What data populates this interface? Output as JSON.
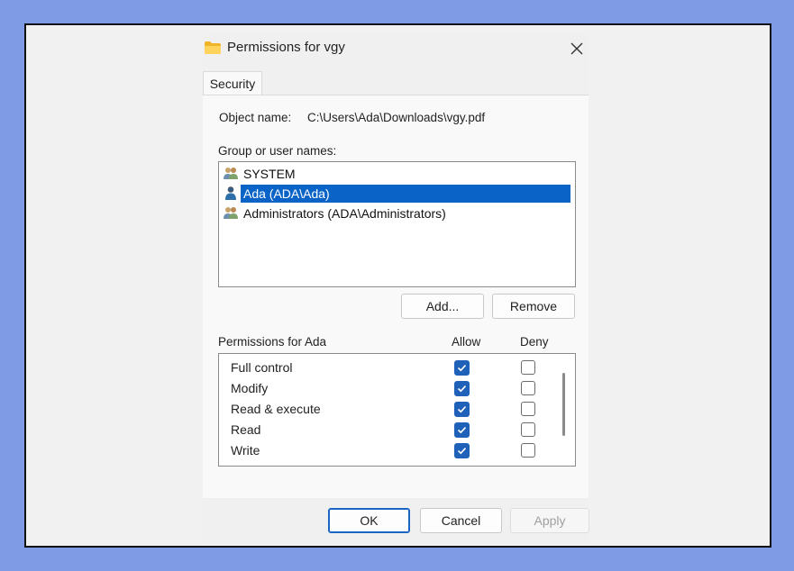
{
  "window": {
    "title": "Permissions for vgy",
    "close_icon": "close-icon",
    "folder_icon": "folder-icon"
  },
  "tabs": [
    {
      "label": "Security"
    }
  ],
  "object": {
    "label": "Object name:",
    "value": "C:\\Users\\Ada\\Downloads\\vgy.pdf"
  },
  "groups": {
    "label": "Group or user names:",
    "items": [
      {
        "name": "SYSTEM",
        "icon": "group-users-icon",
        "selected": false
      },
      {
        "name": "Ada (ADA\\Ada)",
        "icon": "user-icon",
        "selected": true
      },
      {
        "name": "Administrators (ADA\\Administrators)",
        "icon": "group-users-icon",
        "selected": false
      }
    ],
    "add_label": "Add...",
    "remove_label": "Remove"
  },
  "permissions": {
    "label": "Permissions for Ada",
    "allow_header": "Allow",
    "deny_header": "Deny",
    "rows": [
      {
        "name": "Full control",
        "allow": true,
        "deny": false
      },
      {
        "name": "Modify",
        "allow": true,
        "deny": false
      },
      {
        "name": "Read & execute",
        "allow": true,
        "deny": false
      },
      {
        "name": "Read",
        "allow": true,
        "deny": false
      },
      {
        "name": "Write",
        "allow": true,
        "deny": false
      }
    ]
  },
  "footer": {
    "ok_label": "OK",
    "cancel_label": "Cancel",
    "apply_label": "Apply"
  },
  "colors": {
    "accent": "#0a64c8",
    "checkbox": "#1f61b8",
    "page_border": "#7f9be5"
  }
}
